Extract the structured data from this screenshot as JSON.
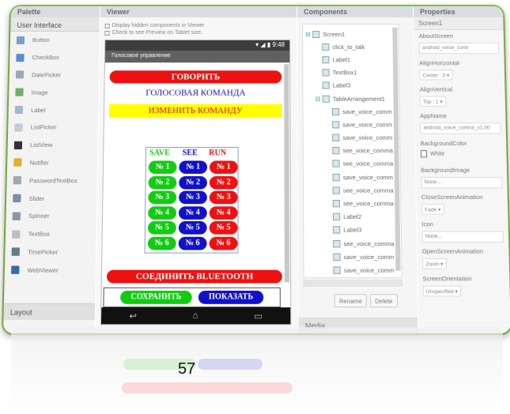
{
  "palette": {
    "header": "Palette",
    "section": "User Interface",
    "items": [
      {
        "label": "Button",
        "icon": "button-icon",
        "color": "#7aa0d0"
      },
      {
        "label": "CheckBox",
        "icon": "checkbox-icon",
        "color": "#5a8fd0"
      },
      {
        "label": "DatePicker",
        "icon": "datepicker-icon",
        "color": "#9aa7b5"
      },
      {
        "label": "Image",
        "icon": "image-icon",
        "color": "#6fb06a"
      },
      {
        "label": "Label",
        "icon": "label-icon",
        "color": "#a7b7cc"
      },
      {
        "label": "ListPicker",
        "icon": "listpicker-icon",
        "color": "#c5cbd2"
      },
      {
        "label": "ListView",
        "icon": "listview-icon",
        "color": "#333333"
      },
      {
        "label": "Notifier",
        "icon": "notifier-icon",
        "color": "#e0b030"
      },
      {
        "label": "PasswordTextBox",
        "icon": "password-icon",
        "color": "#a0a8b0"
      },
      {
        "label": "Slider",
        "icon": "slider-icon",
        "color": "#7a8fa8"
      },
      {
        "label": "Spinner",
        "icon": "spinner-icon",
        "color": "#8a98a8"
      },
      {
        "label": "TextBox",
        "icon": "textbox-icon",
        "color": "#b8c0c8"
      },
      {
        "label": "TimePicker",
        "icon": "timepicker-icon",
        "color": "#6a7a8a"
      },
      {
        "label": "WebViewer",
        "icon": "webviewer-icon",
        "color": "#3a6ab0"
      }
    ],
    "layout_section": "Layout"
  },
  "viewer": {
    "header": "Viewer",
    "check1": "Display hidden components in Viewer",
    "check2": "Check to see Preview on Tablet size.",
    "status_time": "9:48",
    "screen_title": "Голосовое управление",
    "btn_speak": "ГОВОРИТЬ",
    "label_command": "ГОЛОСОВАЯ КОМАНДА",
    "btn_change": "ИЗМЕНИТЬ КОМАНДУ",
    "col_save": "SAVE",
    "col_see": "SEE",
    "col_run": "RUN",
    "grid_labels": [
      "№ 1",
      "№ 2",
      "№ 3",
      "№ 4",
      "№ 5",
      "№ 6"
    ],
    "btn_bluetooth": "СОЕДИНИТЬ BLUETOOTH",
    "btn_save": "СОХРАНИТЬ",
    "btn_show": "ПОКАЗАТЬ"
  },
  "components": {
    "header": "Components",
    "tree": [
      {
        "label": "Screen1",
        "level": 0,
        "toggle": "⊟"
      },
      {
        "label": "click_to_talk",
        "level": 1,
        "toggle": ""
      },
      {
        "label": "Label1",
        "level": 1,
        "toggle": ""
      },
      {
        "label": "TextBox1",
        "level": 1,
        "toggle": ""
      },
      {
        "label": "Label3",
        "level": 1,
        "toggle": ""
      },
      {
        "label": "TableArrangement1",
        "level": 1,
        "toggle": "⊟"
      },
      {
        "label": "save_voice_comm",
        "level": 2,
        "toggle": ""
      },
      {
        "label": "save_voice_comm",
        "level": 2,
        "toggle": ""
      },
      {
        "label": "save_voice_comm",
        "level": 2,
        "toggle": ""
      },
      {
        "label": "see_voice_comma",
        "level": 2,
        "toggle": ""
      },
      {
        "label": "see_voice_comma",
        "level": 2,
        "toggle": ""
      },
      {
        "label": "save_voice_comm",
        "level": 2,
        "toggle": ""
      },
      {
        "label": "see_voice_comma",
        "level": 2,
        "toggle": ""
      },
      {
        "label": "see_voice_comma",
        "level": 2,
        "toggle": ""
      },
      {
        "label": "Label2",
        "level": 2,
        "toggle": ""
      },
      {
        "label": "Label3",
        "level": 2,
        "toggle": ""
      },
      {
        "label": "see_voice_comma",
        "level": 2,
        "toggle": ""
      },
      {
        "label": "save_voice_comm",
        "level": 2,
        "toggle": ""
      },
      {
        "label": "save_voice_comm",
        "level": 2,
        "toggle": ""
      }
    ],
    "rename": "Rename",
    "delete": "Delete",
    "media": "Media"
  },
  "properties": {
    "header": "Properties",
    "component": "Screen1",
    "items": [
      {
        "name": "AboutScreen",
        "value": "android_voice_contr",
        "kind": "text"
      },
      {
        "name": "AlignHorizontal",
        "value": "Center : 3 ▾",
        "kind": "drop"
      },
      {
        "name": "AlignVertical",
        "value": "Top : 1 ▾",
        "kind": "drop"
      },
      {
        "name": "AppName",
        "value": "android_voice_control_v1.00",
        "kind": "text"
      },
      {
        "name": "BackgroundColor",
        "value": "White",
        "kind": "color"
      },
      {
        "name": "BackgroundImage",
        "value": "None...",
        "kind": "text"
      },
      {
        "name": "CloseScreenAnimation",
        "value": "Fade ▾",
        "kind": "drop"
      },
      {
        "name": "Icon",
        "value": "None...",
        "kind": "text"
      },
      {
        "name": "OpenScreenAnimation",
        "value": "Zoom ▾",
        "kind": "drop"
      },
      {
        "name": "ScreenOrientation",
        "value": "Unspecified ▾",
        "kind": "drop"
      }
    ]
  },
  "colors": {
    "red": "#ee1111",
    "green": "#11cc11",
    "blue": "#1111cc",
    "yellow": "#ffff00",
    "accent_border": "#8fd14f"
  },
  "page_number": "57"
}
